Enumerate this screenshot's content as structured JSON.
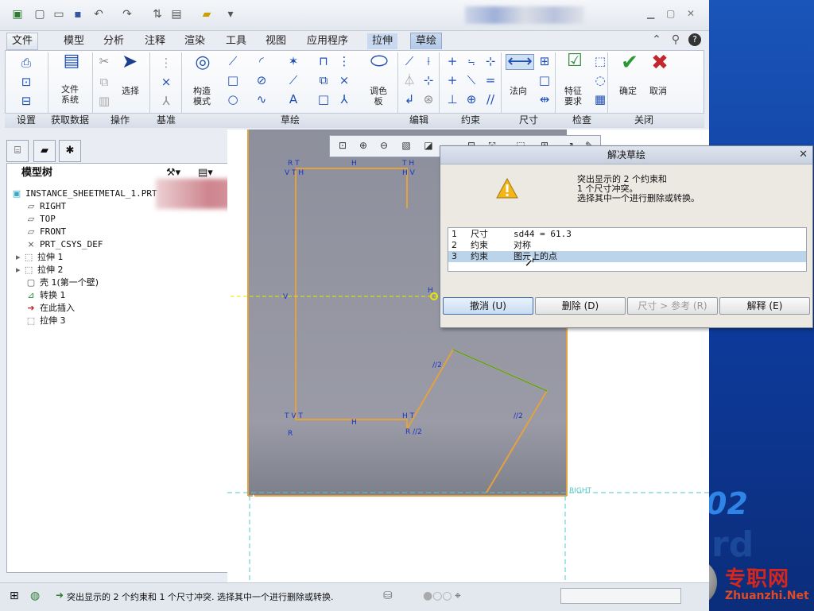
{
  "quick_access": {
    "icons": [
      "app-icon",
      "new-icon",
      "open-icon",
      "save-icon",
      "undo-icon",
      "redo-icon",
      "regenerate-icon",
      "windows-icon",
      "close-window-icon",
      "customize-icon"
    ]
  },
  "ribbon": {
    "tabs": [
      "文件",
      "模型",
      "分析",
      "注释",
      "渲染",
      "工具",
      "视图",
      "应用程序",
      "拉伸",
      "草绘"
    ],
    "active_tab": "草绘",
    "buttons": {
      "file_system": "文件\n系统",
      "select": "选择",
      "construction_mode": "构造\n模式",
      "palette": "调色\n板",
      "normal": "法向",
      "feature_requirements": "特征\n要求",
      "ok": "确定",
      "cancel": "取消"
    },
    "groups": [
      "设置",
      "获取数据",
      "操作",
      "基准",
      "草绘",
      "编辑",
      "约束",
      "尺寸",
      "检查",
      "关闭"
    ]
  },
  "model_tree": {
    "title": "模型树",
    "items": [
      {
        "label": "INSTANCE_SHEETMETAL_1.PRT",
        "icon": "part-icon"
      },
      {
        "label": "RIGHT",
        "icon": "datum-plane-icon"
      },
      {
        "label": "TOP",
        "icon": "datum-plane-icon"
      },
      {
        "label": "FRONT",
        "icon": "datum-plane-icon"
      },
      {
        "label": "PRT_CSYS_DEF",
        "icon": "csys-icon"
      },
      {
        "label": "拉伸 1",
        "icon": "extrude-icon"
      },
      {
        "label": "拉伸 2",
        "icon": "extrude-icon"
      },
      {
        "label": "壳 1(第一个壁)",
        "icon": "shell-icon"
      },
      {
        "label": "转换 1",
        "icon": "convert-icon"
      },
      {
        "label": "在此插入",
        "icon": "insert-here-icon"
      },
      {
        "label": "拉伸 3",
        "icon": "extrude-icon"
      }
    ]
  },
  "sketch": {
    "labels": {
      "right_plane": "RIGHT"
    }
  },
  "dialog": {
    "title": "解决草绘",
    "message": [
      "突出显示的 2 个约束和",
      "1 个尺寸冲突。",
      "选择其中一个进行删除或转换。"
    ],
    "rows": [
      {
        "n": "1",
        "type": "尺寸",
        "desc": "sd44  =  61.3"
      },
      {
        "n": "2",
        "type": "约束",
        "desc": "对称"
      },
      {
        "n": "3",
        "type": "约束",
        "desc": "图元上的点"
      }
    ],
    "selected_row": 3,
    "buttons": {
      "undo": "撤消 (U)",
      "delete": "删除 (D)",
      "dim_ref": "尺寸 > 参考 (R)",
      "explain": "解释 (E)"
    }
  },
  "status_bar": {
    "message": "突出显示的 2 个约束和 1 个尺寸冲突. 选择其中一个进行删除或转换."
  },
  "desktop": {
    "brand_fragment": "02",
    "ghost_text": "rd"
  },
  "watermark": {
    "cn": "专职网",
    "url": "Zhuanzhi.Net"
  }
}
